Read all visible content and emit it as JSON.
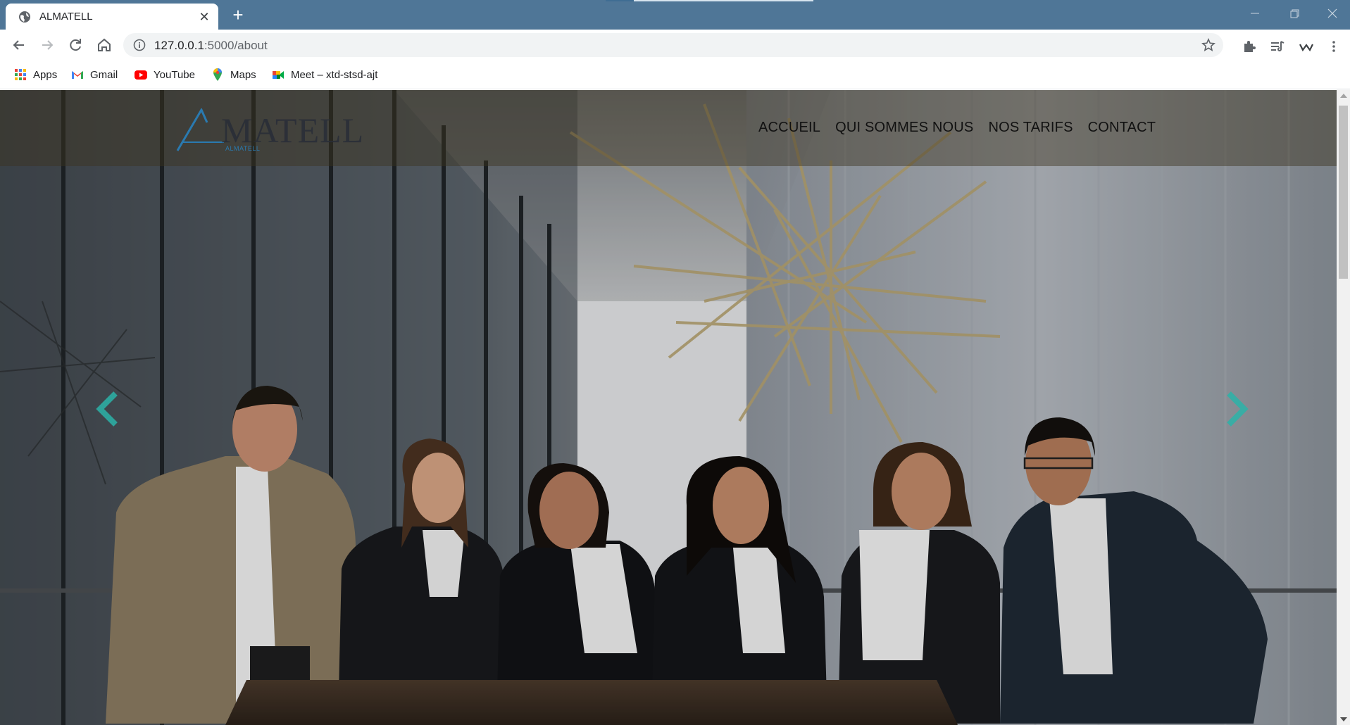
{
  "browser": {
    "tab_title": "ALMATELL",
    "url_host": "127.0.0.1",
    "url_path": ":5000/about",
    "theme_color": "#4f7697",
    "bookmarks": [
      {
        "label": "Apps",
        "icon": "apps-grid-icon"
      },
      {
        "label": "Gmail",
        "icon": "gmail-icon"
      },
      {
        "label": "YouTube",
        "icon": "youtube-icon"
      },
      {
        "label": "Maps",
        "icon": "maps-icon"
      },
      {
        "label": "Meet – xtd-stsd-ajt",
        "icon": "meet-icon"
      }
    ]
  },
  "site": {
    "logo_text": "MATELL",
    "logo_tagline": "ALMATELL",
    "nav": [
      "ACCUEIL",
      "QUI SOMMES NOUS",
      "NOS TARIFS",
      "CONTACT"
    ],
    "accent_color": "#2bb3a8",
    "hero_image": "team-photo"
  }
}
